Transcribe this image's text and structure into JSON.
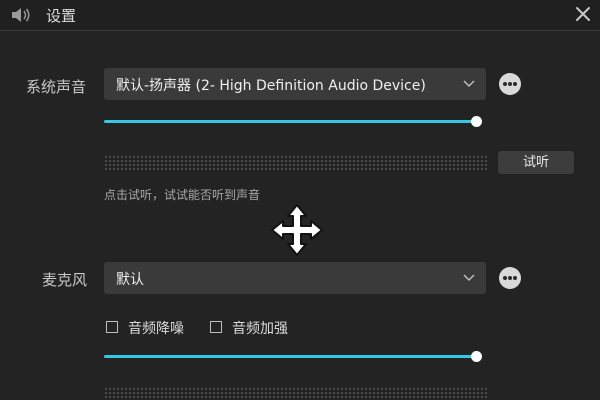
{
  "window": {
    "title": "设置",
    "close_icon": "close-icon",
    "speaker_icon": "speaker-icon"
  },
  "system_sound": {
    "label": "系统声音",
    "device": "默认-扬声器 (2- High Definition Audio Device)",
    "volume": 1.0,
    "test_button": "试听",
    "hint": "点击试听，试试能否听到声音"
  },
  "microphone": {
    "label": "麦克风",
    "device": "默认",
    "noise_reduction_label": "音频降噪",
    "noise_reduction_checked": false,
    "enhance_label": "音频加强",
    "enhance_checked": false,
    "volume": 1.0
  },
  "colors": {
    "accent": "#36c6e6",
    "background": "#232323"
  }
}
